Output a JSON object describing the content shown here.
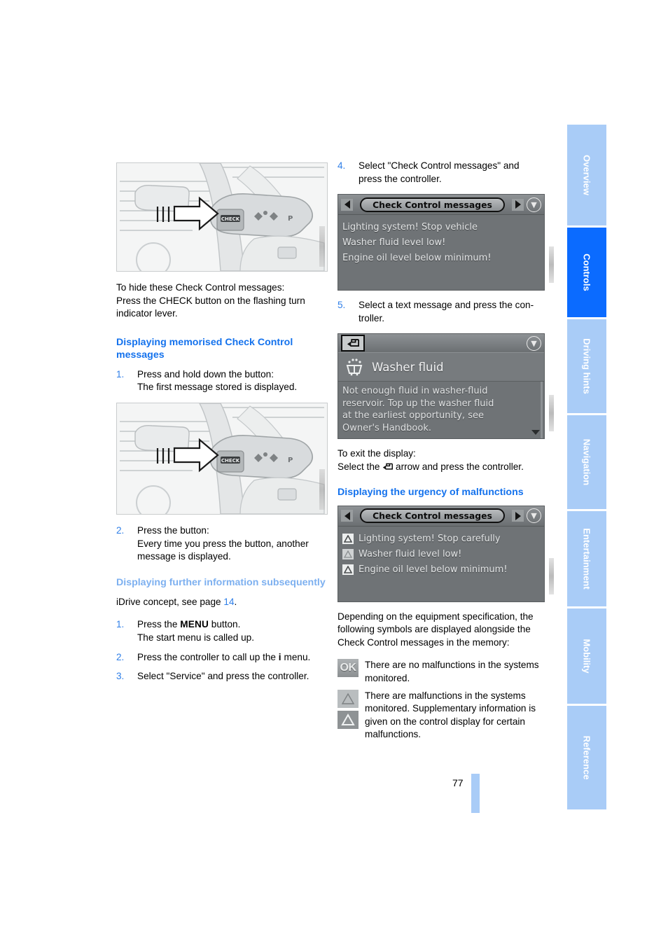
{
  "page": {
    "number": "77"
  },
  "left_column": {
    "figure1": {
      "name": "turn-indicator-lever-check-button",
      "alt_label": "CHECK"
    },
    "intro_para": "To hide these Check Control messages:\nPress the CHECK button on the flashing turn indicator lever.",
    "intro_lines": [
      "To hide these Check Control messages:",
      "Press the CHECK button on the flashing turn",
      "indicator lever."
    ],
    "heading_memorised": "Displaying memorised Check Control messages",
    "steps_memorised": [
      {
        "num": "1.",
        "main": "Press and hold down the button:",
        "sub": "The first message stored is displayed."
      }
    ],
    "figure2": {
      "name": "turn-indicator-lever-check-button",
      "alt_label": "CHECK"
    },
    "steps_memorised2": [
      {
        "num": "2.",
        "main": "Press the button:",
        "sub": "Every time you press the button, another message is displayed."
      }
    ],
    "heading_further": "Displaying further information subsequently",
    "idrive_ref_prefix": "iDrive concept, see page ",
    "idrive_ref_page": "14",
    "idrive_ref_suffix": ".",
    "steps_further": [
      {
        "num": "1.",
        "main_pre": "Press the ",
        "main_key": "MENU",
        "main_post": " button.",
        "sub": "The start menu is called up."
      },
      {
        "num": "2.",
        "main_pre": "Press the controller to call up the ",
        "main_key": "i",
        "main_post": " menu.",
        "sub": ""
      },
      {
        "num": "3.",
        "main_pre": "Select \"Service\" and press the controller.",
        "main_key": "",
        "main_post": "",
        "sub": ""
      }
    ]
  },
  "right_column": {
    "step4": {
      "num": "4.",
      "line1": "Select \"Check Control messages\" and",
      "line2": "press the controller."
    },
    "screen_messages": {
      "title": "Check Control messages",
      "left_arrow_icon": "triangle-left-icon",
      "right_arrow_icon": "triangle-right-icon",
      "status_icon": "circle-down-arrow-icon",
      "messages": [
        "Lighting system! Stop vehicle",
        "Washer fluid level low!",
        "Engine oil level below minimum!"
      ]
    },
    "step5": {
      "num": "5.",
      "line1": "Select a text message and press the con-",
      "line2": "troller."
    },
    "screen_washer": {
      "back_icon": "back-arrow-icon",
      "status_icon": "circle-down-arrow-icon",
      "item_icon": "washer-fluid-icon",
      "item_title": "Washer fluid",
      "body_lines": [
        "Not enough fluid in washer-fluid",
        "reservoir. Top up the washer fluid",
        "at the earliest opportunity, see",
        "Owner's Handbook."
      ],
      "scroll_down_icon": "triangle-down-icon"
    },
    "exit_lines": {
      "line1": "To exit the display:",
      "line2_pre": "Select the ",
      "line2_post": " arrow and press the controller."
    },
    "heading_urgency": "Displaying the urgency of malfunctions",
    "screen_urgency": {
      "title": "Check Control messages",
      "left_arrow_icon": "triangle-left-icon",
      "right_arrow_icon": "triangle-right-icon",
      "status_icon": "circle-down-arrow-icon",
      "messages": [
        {
          "icon": "warning-triangle-strong-icon",
          "text": "Lighting system! Stop carefully"
        },
        {
          "icon": "warning-triangle-light-icon",
          "text": "Washer fluid level low!"
        },
        {
          "icon": "warning-triangle-strong-icon",
          "text": "Engine oil level below minimum!"
        }
      ]
    },
    "symbols_intro_lines": [
      "Depending on the equipment specification, the",
      "following symbols are displayed alongside the",
      "Check Control messages in the memory:"
    ],
    "legend": [
      {
        "icon": "ok-symbol-icon",
        "label": "OK",
        "text": "There are no malfunctions in the systems monitored."
      },
      {
        "icon": "warning-triangle-pair-icon",
        "label": "",
        "text": "There are malfunctions in the systems monitored. Supplementary information is given on the control display for certain malfunctions."
      }
    ]
  },
  "sidebar": {
    "tabs": [
      {
        "label": "Overview",
        "active": false
      },
      {
        "label": "Controls",
        "active": true
      },
      {
        "label": "Driving hints",
        "active": false
      },
      {
        "label": "Navigation",
        "active": false
      },
      {
        "label": "Entertainment",
        "active": false
      },
      {
        "label": "Mobility",
        "active": false
      },
      {
        "label": "Reference",
        "active": false
      }
    ]
  },
  "colors": {
    "heading_blue": "#1472ed",
    "heading_blue_light": "#7db0f0",
    "tab_inactive": "#a9ccf7",
    "tab_active": "#0b6bff",
    "link_blue": "#2f7fe8",
    "screen_gray": "#6f7376"
  }
}
